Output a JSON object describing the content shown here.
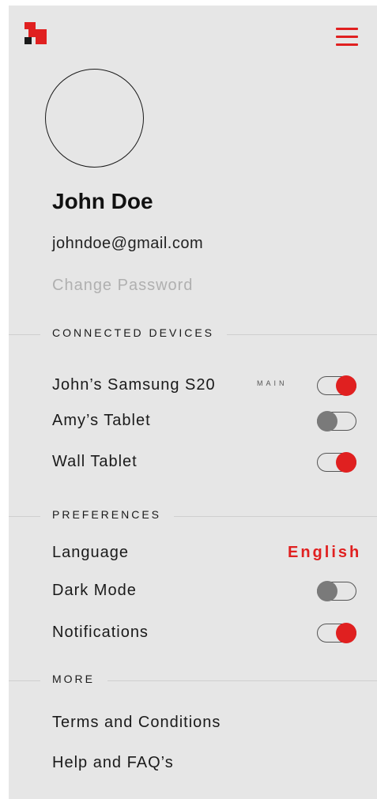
{
  "header": {
    "logo_icon": "brand-logo-icon",
    "menu_icon": "hamburger-menu-icon"
  },
  "profile": {
    "name": "John Doe",
    "email": "johndoe@gmail.com",
    "change_password": "Change Password"
  },
  "connected_devices": {
    "title": "CONNECTED DEVICES",
    "items": [
      {
        "label": "John’s Samsung S20",
        "badge": "MAIN",
        "enabled": true
      },
      {
        "label": "Amy’s Tablet",
        "enabled": false
      },
      {
        "label": "Wall Tablet",
        "enabled": true
      }
    ]
  },
  "preferences": {
    "title": "PREFERENCES",
    "language_label": "Language",
    "language_value": "English",
    "dark_mode_label": "Dark Mode",
    "dark_mode_enabled": false,
    "notifications_label": "Notifications",
    "notifications_enabled": true
  },
  "more": {
    "title": "MORE",
    "terms": "Terms and Conditions",
    "help": "Help and FAQ’s"
  },
  "colors": {
    "accent": "#e02020",
    "panel": "#e6e6e6",
    "muted": "#b0b0b0",
    "toggle_off": "#7a7a7a"
  }
}
